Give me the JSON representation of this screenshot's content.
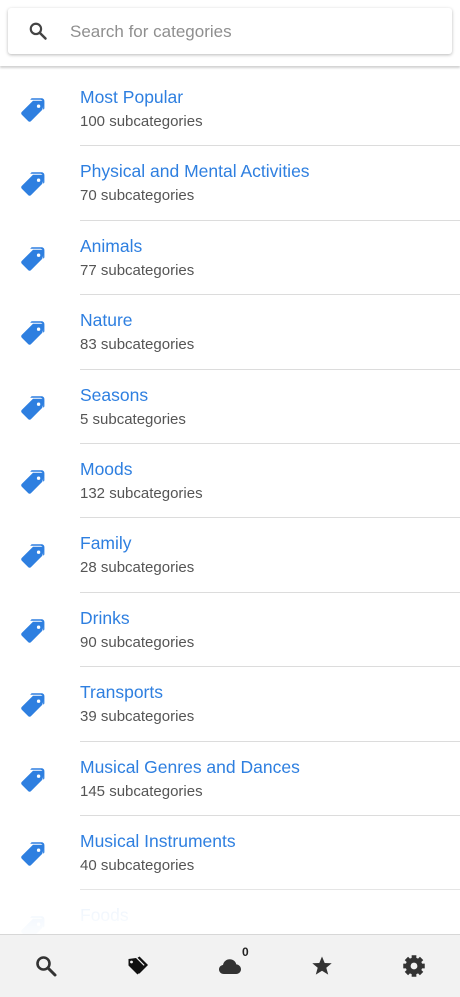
{
  "search": {
    "placeholder": "Search for categories",
    "value": ""
  },
  "colors": {
    "accent": "#2e7fe0",
    "subtitle": "#555555",
    "nav_icon": "#333333"
  },
  "categories": [
    {
      "title": "Most Popular",
      "subtitle": "100 subcategories"
    },
    {
      "title": "Physical and Mental Activities",
      "subtitle": "70 subcategories"
    },
    {
      "title": "Animals",
      "subtitle": "77 subcategories"
    },
    {
      "title": "Nature",
      "subtitle": "83 subcategories"
    },
    {
      "title": "Seasons",
      "subtitle": "5 subcategories"
    },
    {
      "title": "Moods",
      "subtitle": "132 subcategories"
    },
    {
      "title": "Family",
      "subtitle": "28 subcategories"
    },
    {
      "title": "Drinks",
      "subtitle": "90 subcategories"
    },
    {
      "title": "Transports",
      "subtitle": "39 subcategories"
    },
    {
      "title": "Musical Genres and Dances",
      "subtitle": "145 subcategories"
    },
    {
      "title": "Musical Instruments",
      "subtitle": "40 subcategories"
    },
    {
      "title": "Foods",
      "subtitle": ""
    }
  ],
  "bottom_nav": {
    "items": [
      {
        "icon": "search-icon"
      },
      {
        "icon": "tag-icon",
        "active": true
      },
      {
        "icon": "cloud-icon",
        "badge": "0"
      },
      {
        "icon": "star-icon"
      },
      {
        "icon": "gear-icon"
      }
    ]
  }
}
